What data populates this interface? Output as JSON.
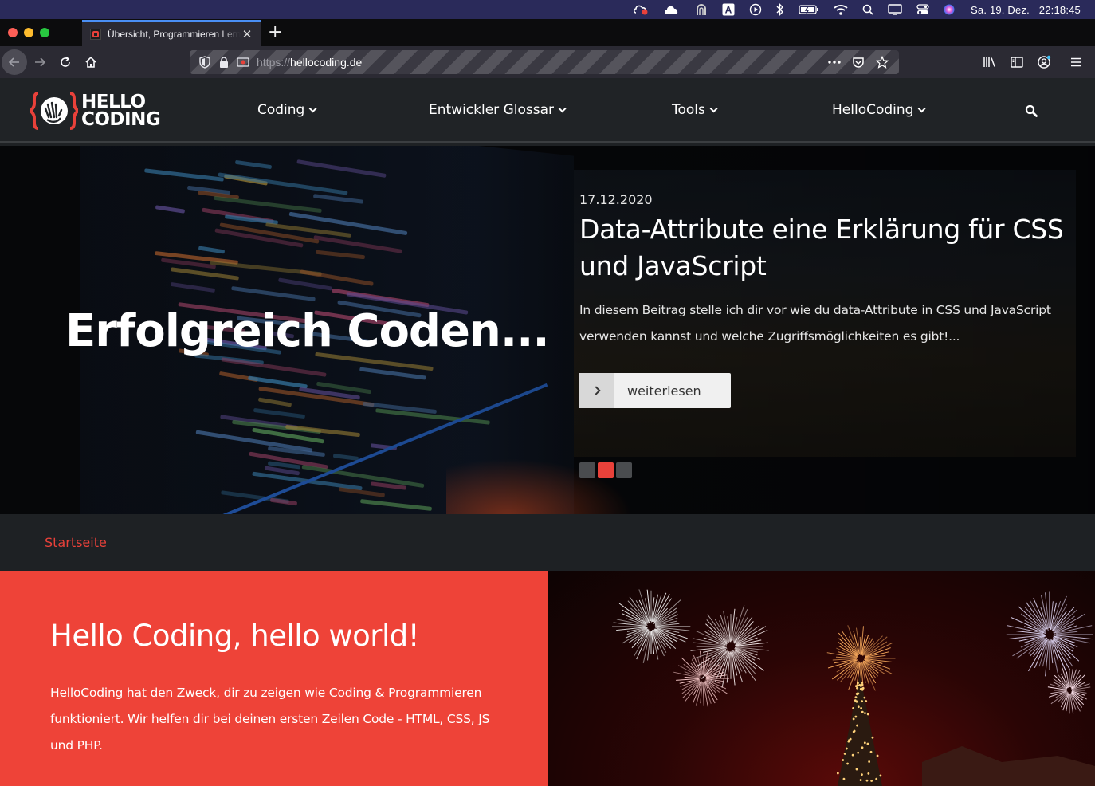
{
  "menubar": {
    "date": "Sa. 19. Dez.",
    "time": "22:18:45",
    "icons": [
      "creative-cloud-icon",
      "cloud-icon",
      "arch-icon",
      "a-icon",
      "play-icon",
      "bluetooth-icon",
      "battery-icon",
      "wifi-icon",
      "spotlight-icon",
      "display-icon",
      "control-center-icon",
      "siri-icon"
    ]
  },
  "browser": {
    "tab_title": "Übersicht, Programmieren Lernen",
    "url_protocol": "https://",
    "url_host": "hellocoding.de"
  },
  "site": {
    "logo_line1": "HELLO",
    "logo_line2": "CODING",
    "nav": [
      "Coding",
      "Entwickler Glossar",
      "Tools",
      "HelloCoding"
    ],
    "accent": "#e9413a"
  },
  "hero": {
    "headline": "Erfolgreich Coden...",
    "date": "17.12.2020",
    "post_title": "Data-Attribute eine Erklärung für CSS und JavaScript",
    "excerpt": "In diesem Beitrag stelle ich dir vor wie du data-Attribute in CSS und JavaScript verwenden kannst und welche Zugriffsmöglichkeiten es gibt!...",
    "read_more": "weiterlesen",
    "slides_total": 3,
    "slide_active": 2
  },
  "breadcrumb": {
    "home": "Startseite"
  },
  "intro": {
    "heading": "Hello Coding, hello world!",
    "text": "HelloCoding hat den Zweck, dir zu zeigen wie Coding & Programmieren funktioniert. Wir helfen dir bei deinen ersten Zeilen Code - HTML, CSS, JS und PHP."
  }
}
